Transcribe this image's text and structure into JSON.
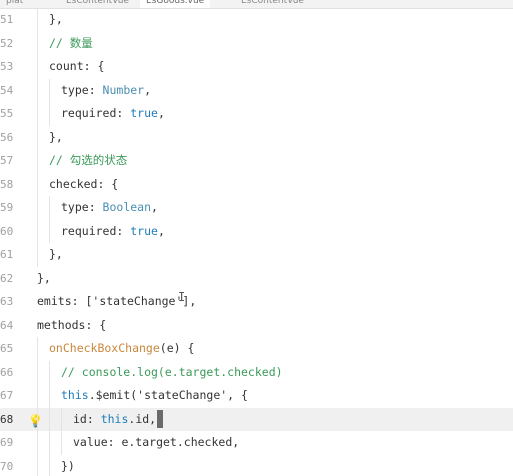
{
  "tabs": [
    {
      "label": "plat"
    },
    {
      "label": "EsContentVue"
    },
    {
      "label": "EsGoods.vue"
    },
    {
      "label": "EsContentVue"
    }
  ],
  "lines": [
    {
      "num": "51",
      "text": "},"
    },
    {
      "num": "52",
      "text": "// 数量"
    },
    {
      "num": "53",
      "text": "count: {"
    },
    {
      "num": "54",
      "text_a": "type: ",
      "text_b": "Number",
      "text_c": ","
    },
    {
      "num": "55",
      "text_a": "required: ",
      "text_b": "true",
      "text_c": ","
    },
    {
      "num": "56",
      "text": "},"
    },
    {
      "num": "57",
      "text": "// 勾选的状态"
    },
    {
      "num": "58",
      "text": "checked: {"
    },
    {
      "num": "59",
      "text_a": "type: ",
      "text_b": "Boolean",
      "text_c": ","
    },
    {
      "num": "60",
      "text_a": "required: ",
      "text_b": "true",
      "text_c": ","
    },
    {
      "num": "61",
      "text": "},"
    },
    {
      "num": "62",
      "text": "},"
    },
    {
      "num": "63",
      "text_a": "emits: [",
      "text_b": "'stateChange'",
      "text_c": "],"
    },
    {
      "num": "64",
      "text": "methods: {"
    },
    {
      "num": "65",
      "text_a": "onCheckBoxChange",
      "text_b": "(e) {"
    },
    {
      "num": "66",
      "text": "// console.log(e.target.checked)"
    },
    {
      "num": "67",
      "text_a": "this",
      "text_b": ".$emit('stateChange', {"
    },
    {
      "num": "68",
      "text_a": "id: ",
      "text_b": "this",
      "text_c": ".id,"
    },
    {
      "num": "69",
      "text": "value: e.target.checked,"
    },
    {
      "num": "70",
      "text": "})"
    }
  ]
}
